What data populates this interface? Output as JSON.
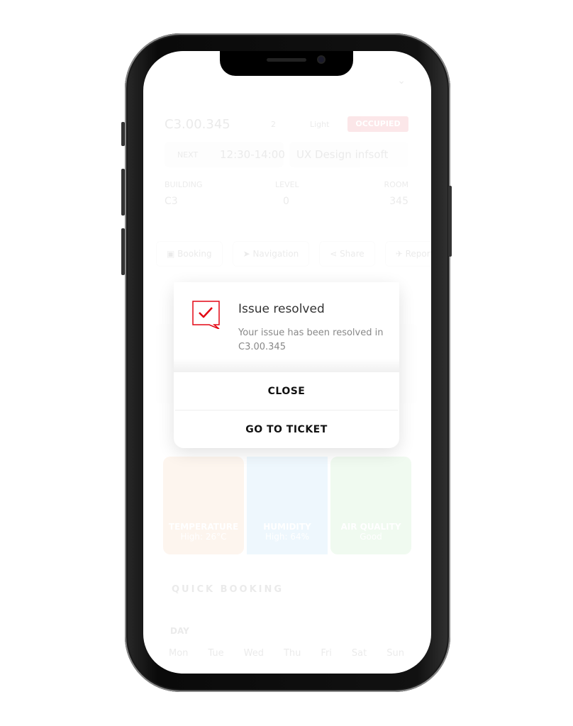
{
  "room": {
    "name": "C3.00.345",
    "people": "2",
    "light": "Light",
    "status": "OCCUPIED",
    "status_color": "#e30613",
    "next_label": "NEXT",
    "next_time": "12:30-14:00",
    "next_event": "UX Design infsoft",
    "building_label": "BUILDING",
    "level_label": "LEVEL",
    "room_label": "ROOM",
    "building": "C3",
    "level": "0",
    "room": "345"
  },
  "actions": [
    {
      "label": "Booking",
      "icon": "booking-icon"
    },
    {
      "label": "Navigation",
      "icon": "navigation-icon"
    },
    {
      "label": "Share",
      "icon": "share-icon"
    },
    {
      "label": "Report",
      "icon": "report-icon"
    }
  ],
  "sensors": [
    {
      "label": "TEMPERATURE",
      "value": "High: 26°C",
      "color": "#fbe3cf"
    },
    {
      "label": "HUMIDITY",
      "value": "High: 64%",
      "color": "#cfe9fb"
    },
    {
      "label": "AIR QUALITY",
      "value": "Good",
      "color": "#d6f2d6"
    }
  ],
  "quick_booking": {
    "title": "QUICK BOOKING",
    "day_label": "DAY",
    "days": [
      "Mon",
      "Tue",
      "Wed",
      "Thu",
      "Fri",
      "Sat",
      "Sun"
    ]
  },
  "dialog": {
    "title": "Issue resolved",
    "message": "Your issue has been resolved in  C3.00.345",
    "close": "CLOSE",
    "go_to_ticket": "GO TO TICKET",
    "accent": "#e30613"
  }
}
